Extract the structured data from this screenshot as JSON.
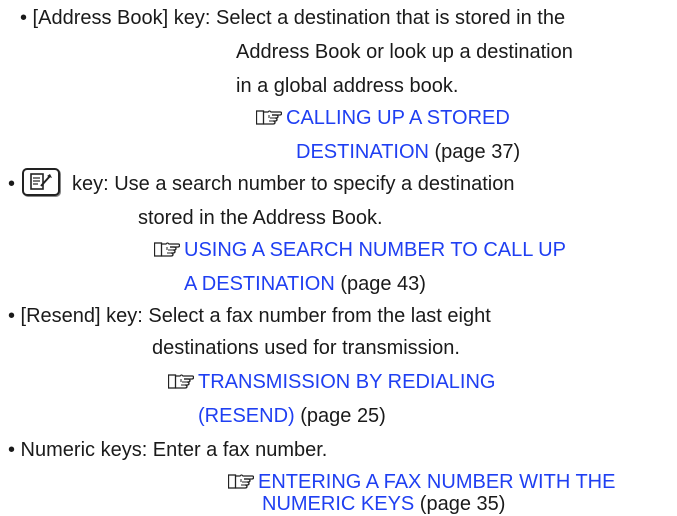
{
  "items": [
    {
      "lines": [
        "• [Address Book] key: Select a destination that is stored in the",
        "Address Book or look up a destination",
        "in a global address book."
      ],
      "ref": {
        "icon": "pointing-hand-icon",
        "link": [
          "CALLING UP A STORED",
          "DESTINATION"
        ],
        "page": " (page 37)"
      }
    },
    {
      "bullet": "•",
      "key_icon": "search-number-key-icon",
      "lines": [
        "key: Use a search number to specify a destination",
        "stored in the Address Book."
      ],
      "ref": {
        "icon": "pointing-hand-icon",
        "link": [
          "USING A SEARCH NUMBER TO CALL UP",
          "A DESTINATION"
        ],
        "page": " (page 43)"
      }
    },
    {
      "lines": [
        "• [Resend] key: Select a fax number from the last eight",
        "destinations used for transmission."
      ],
      "ref": {
        "icon": "pointing-hand-icon",
        "link": [
          "TRANSMISSION BY REDIALING",
          "(RESEND)"
        ],
        "page": " (page 25)"
      }
    },
    {
      "lines": [
        "• Numeric keys: Enter a fax number."
      ],
      "ref": {
        "icon": "pointing-hand-icon",
        "link": [
          "ENTERING A FAX NUMBER WITH THE",
          "NUMERIC KEYS"
        ],
        "page": " (page 35)"
      }
    }
  ],
  "colors": {
    "text": "#1a1a1a",
    "link": "#1f3ff2"
  }
}
